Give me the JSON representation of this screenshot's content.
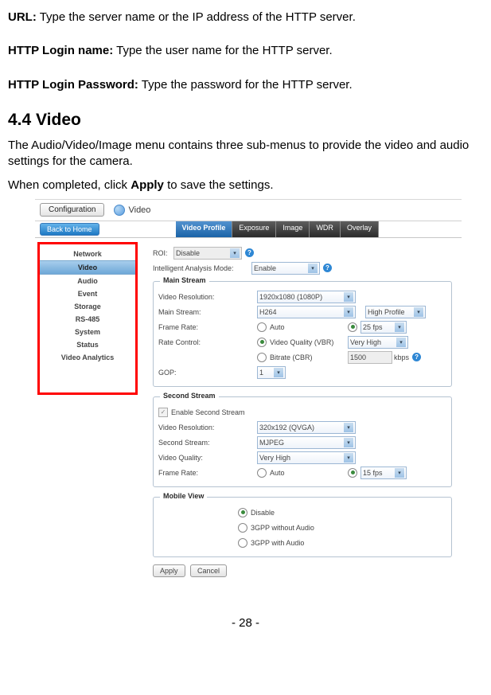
{
  "doc": {
    "url_label": "URL:",
    "url_text": " Type the server name or the IP address of the HTTP server.",
    "login_name_label": "HTTP Login name:",
    "login_name_text": " Type the user name for the HTTP server.",
    "login_pw_label": "HTTP Login Password:",
    "login_pw_text": " Type the password for the HTTP server.",
    "section_heading": "4.4  Video",
    "para1": "The Audio/Video/Image menu contains three sub-menus to provide the video and audio settings for the camera.",
    "para2a": "When completed, click ",
    "para2_apply": "Apply",
    "para2b": " to save the settings.",
    "page_num": "- 28 -"
  },
  "ss": {
    "config_btn": "Configuration",
    "title": "Video",
    "back_btn": "Back to Home",
    "tabs": [
      "Video Profile",
      "Exposure",
      "Image",
      "WDR",
      "Overlay"
    ],
    "sidebar": [
      "Network",
      "Video",
      "Audio",
      "Event",
      "Storage",
      "RS-485",
      "System",
      "Status",
      "Video Analytics"
    ],
    "roi_label": "ROI:",
    "roi_value": "Disable",
    "iam_label": "Intelligent Analysis Mode:",
    "iam_value": "Enable",
    "main_stream": {
      "title": "Main Stream",
      "vres_label": "Video Resolution:",
      "vres_value": "1920x1080 (1080P)",
      "ms_label": "Main Stream:",
      "ms_value": "H264",
      "profile_value": "High Profile",
      "fr_label": "Frame Rate:",
      "fr_auto": "Auto",
      "fr_value": "25 fps",
      "rc_label": "Rate Control:",
      "rc_vbr": "Video Quality (VBR)",
      "rc_vbr_value": "Very High",
      "rc_cbr": "Bitrate (CBR)",
      "rc_cbr_value": "1500",
      "rc_cbr_unit": "kbps",
      "gop_label": "GOP:",
      "gop_value": "1"
    },
    "second_stream": {
      "title": "Second Stream",
      "enable_label": "Enable Second Stream",
      "vres_label": "Video Resolution:",
      "vres_value": "320x192 (QVGA)",
      "ss_label": "Second Stream:",
      "ss_value": "MJPEG",
      "vq_label": "Video Quality:",
      "vq_value": "Very High",
      "fr_label": "Frame Rate:",
      "fr_auto": "Auto",
      "fr_value": "15 fps"
    },
    "mobile": {
      "title": "Mobile View",
      "opt1": "Disable",
      "opt2": "3GPP without Audio",
      "opt3": "3GPP with Audio"
    },
    "apply_btn": "Apply",
    "cancel_btn": "Cancel"
  }
}
